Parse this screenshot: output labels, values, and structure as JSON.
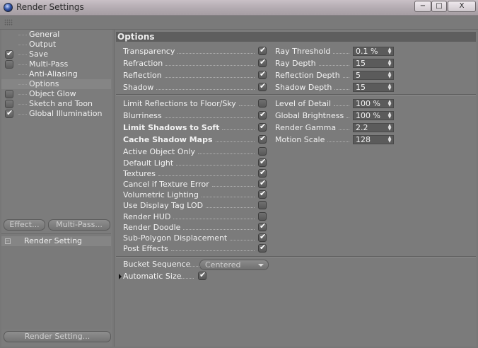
{
  "window": {
    "title": "Render Settings",
    "controls": {
      "minimize": "−",
      "maximize": "□",
      "close": "X"
    }
  },
  "sidebar": {
    "items": [
      {
        "label": "General",
        "checkbox": false,
        "checked": false,
        "selected": false
      },
      {
        "label": "Output",
        "checkbox": false,
        "checked": false,
        "selected": false
      },
      {
        "label": "Save",
        "checkbox": true,
        "checked": true,
        "selected": false
      },
      {
        "label": "Multi-Pass",
        "checkbox": true,
        "checked": false,
        "selected": false
      },
      {
        "label": "Anti-Aliasing",
        "checkbox": false,
        "checked": false,
        "selected": false
      },
      {
        "label": "Options",
        "checkbox": false,
        "checked": false,
        "selected": true
      },
      {
        "label": "Object Glow",
        "checkbox": true,
        "checked": false,
        "selected": false
      },
      {
        "label": "Sketch and Toon",
        "checkbox": true,
        "checked": false,
        "selected": false
      },
      {
        "label": "Global Illumination",
        "checkbox": true,
        "checked": true,
        "selected": false
      }
    ],
    "effect_button": "Effect...",
    "multipass_button": "Multi-Pass...",
    "settings_list": [
      {
        "label": "Render Setting"
      }
    ],
    "render_setting_button": "Render Setting..."
  },
  "options": {
    "header": "Options",
    "top_left": [
      {
        "label": "Transparency",
        "checked": true
      },
      {
        "label": "Refraction",
        "checked": true
      },
      {
        "label": "Reflection",
        "checked": true
      },
      {
        "label": "Shadow",
        "checked": true
      }
    ],
    "top_right": [
      {
        "label": "Ray Threshold",
        "value": "0.1 %"
      },
      {
        "label": "Ray Depth",
        "value": "15"
      },
      {
        "label": "Reflection Depth",
        "value": "5"
      },
      {
        "label": "Shadow Depth",
        "value": "15"
      }
    ],
    "main_left": [
      {
        "label": "Limit Reflections to Floor/Sky",
        "checked": false,
        "bold": false
      },
      {
        "label": "Blurriness",
        "checked": true,
        "bold": false
      },
      {
        "label": "Limit Shadows to Soft",
        "checked": true,
        "bold": true
      },
      {
        "label": "Cache Shadow Maps",
        "checked": true,
        "bold": true
      },
      {
        "label": "Active Object Only",
        "checked": false,
        "bold": false
      },
      {
        "label": "Default Light",
        "checked": true,
        "bold": false
      },
      {
        "label": "Textures",
        "checked": true,
        "bold": false
      },
      {
        "label": "Cancel if Texture Error",
        "checked": true,
        "bold": false
      },
      {
        "label": "Volumetric Lighting",
        "checked": true,
        "bold": false
      },
      {
        "label": "Use Display Tag LOD",
        "checked": false,
        "bold": false
      },
      {
        "label": "Render HUD",
        "checked": false,
        "bold": false
      },
      {
        "label": "Render Doodle",
        "checked": true,
        "bold": false
      },
      {
        "label": "Sub-Polygon Displacement",
        "checked": true,
        "bold": false
      },
      {
        "label": "Post Effects",
        "checked": true,
        "bold": false
      }
    ],
    "main_right": [
      {
        "label": "Level of Detail",
        "value": "100 %"
      },
      {
        "label": "Global Brightness",
        "value": "100 %"
      },
      {
        "label": "Render Gamma",
        "value": "2.2"
      },
      {
        "label": "Motion Scale",
        "value": "128"
      }
    ],
    "bucket_sequence": {
      "label": "Bucket Sequence",
      "value": "Centered"
    },
    "automatic_size": {
      "label": "Automatic Size",
      "checked": true
    }
  },
  "icons": {
    "app": "cinema4d-sphere-icon",
    "check": "✔",
    "spin": "▲▼",
    "expand": "−"
  }
}
